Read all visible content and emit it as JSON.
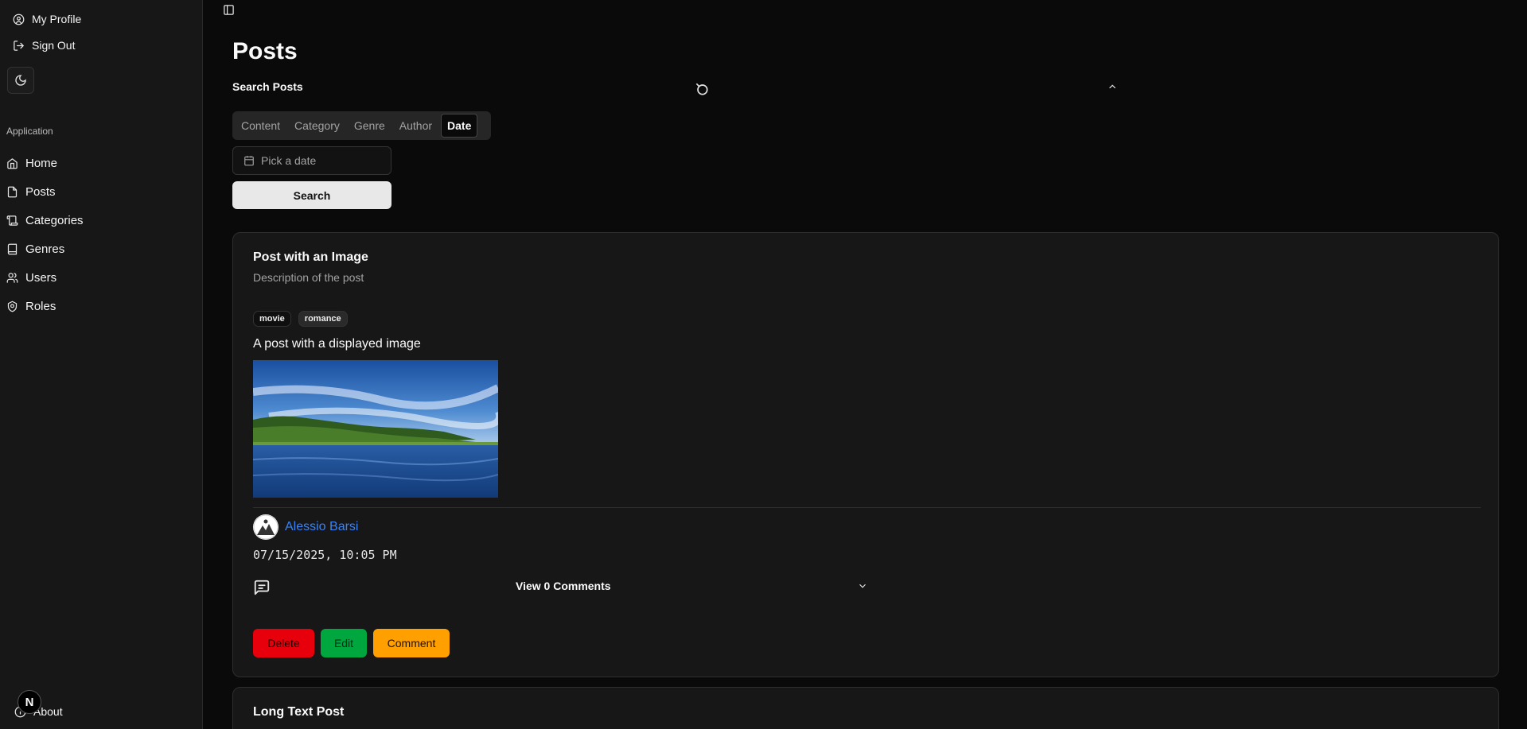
{
  "sidebar": {
    "account": [
      {
        "label": "My Profile",
        "icon": "user-circle-icon"
      },
      {
        "label": "Sign Out",
        "icon": "log-out-icon"
      }
    ],
    "group_label": "Application",
    "items": [
      {
        "label": "Home",
        "icon": "home-icon"
      },
      {
        "label": "Posts",
        "icon": "file-icon"
      },
      {
        "label": "Categories",
        "icon": "scroll-icon"
      },
      {
        "label": "Genres",
        "icon": "book-icon"
      },
      {
        "label": "Users",
        "icon": "users-icon"
      },
      {
        "label": "Roles",
        "icon": "shield-icon"
      }
    ],
    "about_label": "About",
    "badge": "N"
  },
  "main": {
    "title": "Posts",
    "search_title": "Search Posts",
    "tabs": [
      "Content",
      "Category",
      "Genre",
      "Author",
      "Date"
    ],
    "active_tab": "Date",
    "date_placeholder": "Pick a date",
    "search_label": "Search"
  },
  "post": {
    "title": "Post with an Image",
    "description": "Description of the post",
    "tags": [
      "movie",
      "romance"
    ],
    "content": "A post with a displayed image",
    "author": "Alessio Barsi",
    "date": "07/15/2025, 10:05 PM",
    "view_comments": "View 0 Comments",
    "actions": {
      "delete": "Delete",
      "edit": "Edit",
      "comment": "Comment"
    },
    "colors": {
      "delete": "#e7000b",
      "edit": "#00a63e",
      "comment": "#ff9f00",
      "author": "#3b82f6"
    }
  },
  "post2": {
    "title": "Long Text Post"
  }
}
